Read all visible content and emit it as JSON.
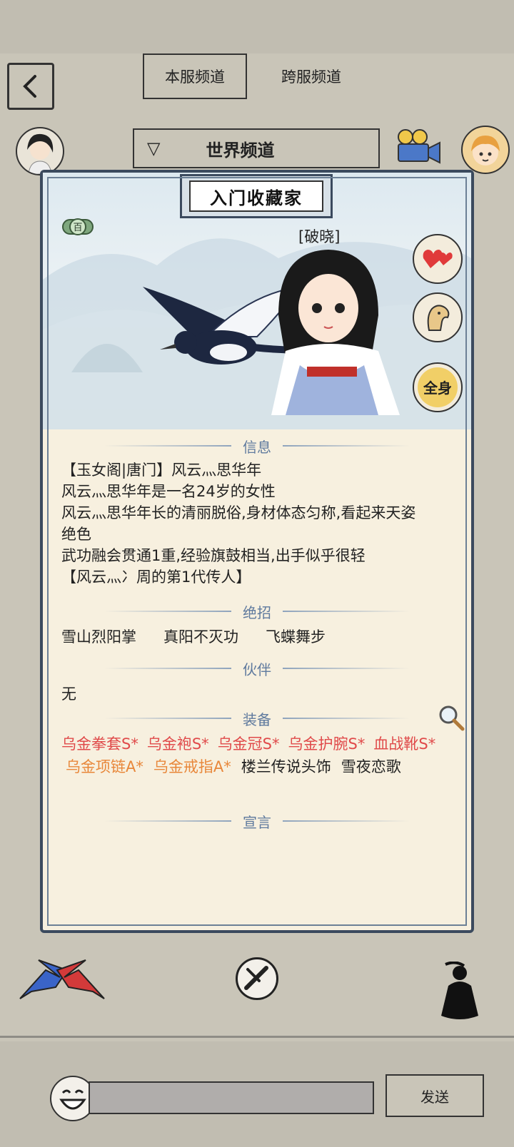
{
  "tabs": {
    "local": "本服频道",
    "cross": "跨服频道"
  },
  "channel": {
    "label": "世界频道"
  },
  "card": {
    "title": "入门收藏家",
    "badge": "百",
    "hero_name": "[破晓]",
    "side_buttons": [
      "heart-icon",
      "horse-icon",
      "body-view-icon"
    ],
    "body_view_label": "全身"
  },
  "info": {
    "heading": "信息",
    "lines": [
      "【玉女阁|唐门】风云灬思华年",
      "风云灬思华年是一名24岁的女性",
      "风云灬思华年长的清丽脱俗,身材体态匀称,看起来天姿",
      "绝色",
      "武功融会贯通1重,经验旗鼓相当,出手似乎很轻",
      "【风云灬冫周的第1代传人】"
    ]
  },
  "skills": {
    "heading": "绝招",
    "items": [
      "雪山烈阳掌",
      "真阳不灭功",
      "飞蝶舞步"
    ]
  },
  "partner": {
    "heading": "伙伴",
    "value": "无"
  },
  "equipment": {
    "heading": "装备",
    "row1": [
      "乌金拳套S*",
      "乌金袍S*",
      "乌金冠S*",
      "乌金护腕S*",
      "血战靴S*"
    ],
    "row2_orange": [
      "乌金项链A*",
      "乌金戒指A*"
    ],
    "row2_normal": [
      "楼兰传说头饰",
      "雪夜恋歌"
    ]
  },
  "declaration": {
    "heading": "宣言"
  },
  "bottom": {
    "send": "发送"
  },
  "colors": {
    "rank_s": "#e04a4a",
    "rank_a": "#e8873a",
    "section_head": "#5f7a9e"
  }
}
